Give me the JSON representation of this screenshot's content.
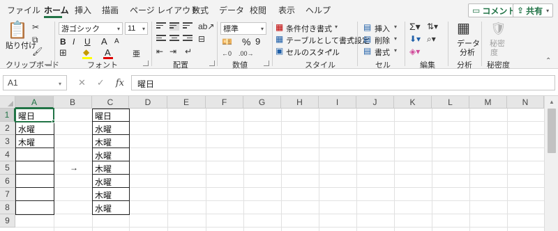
{
  "tabs": [
    "ファイル",
    "ホーム",
    "挿入",
    "描画",
    "ページ レイアウト",
    "数式",
    "データ",
    "校閲",
    "表示",
    "ヘルプ"
  ],
  "header_buttons": {
    "comment": "コメント",
    "share": "共有"
  },
  "ribbon": {
    "clipboard": {
      "paste": "貼り付け",
      "label": "クリップボード"
    },
    "font": {
      "name": "游ゴシック",
      "size": "11",
      "label": "フォント",
      "bold": "B",
      "italic": "I",
      "underline": "U",
      "grow": "A",
      "shrink": "A",
      "color_letter": "A",
      "phonetic": "亜"
    },
    "alignment": {
      "label": "配置"
    },
    "number": {
      "format": "標準",
      "label": "数値",
      "percent": "%",
      "comma": "9"
    },
    "styles": {
      "conditional": "条件付き書式",
      "table": "テーブルとして書式設定",
      "cell": "セルのスタイル",
      "label": "スタイル"
    },
    "cells": {
      "insert": "挿入",
      "delete": "削除",
      "format": "書式",
      "label": "セル"
    },
    "editing": {
      "label": "編集"
    },
    "analysis": {
      "button_line1": "データ",
      "button_line2": "分析",
      "label": "分析"
    },
    "sensitivity": {
      "button_line1": "秘密",
      "button_line2": "度",
      "label": "秘密度"
    }
  },
  "formula_bar": {
    "name_box": "A1",
    "cancel": "✕",
    "enter": "✓",
    "fx": "fx",
    "value": "曜日"
  },
  "columns": [
    "A",
    "B",
    "C",
    "D",
    "E",
    "F",
    "G",
    "H",
    "I",
    "J",
    "K",
    "L",
    "M",
    "N"
  ],
  "rows": [
    "1",
    "2",
    "3",
    "4",
    "5",
    "6",
    "7",
    "8",
    "9"
  ],
  "cells": {
    "A1": "曜日",
    "A2": "水曜",
    "A3": "木曜",
    "B5": "→",
    "C1": "曜日",
    "C2": "水曜",
    "C3": "木曜",
    "C4": "水曜",
    "C5": "木曜",
    "C6": "水曜",
    "C7": "木曜",
    "C8": "水曜"
  },
  "colors": {
    "accent": "#217346",
    "ribbon_bg": "#f3f3f3",
    "header_bg": "#e6e6e6"
  }
}
